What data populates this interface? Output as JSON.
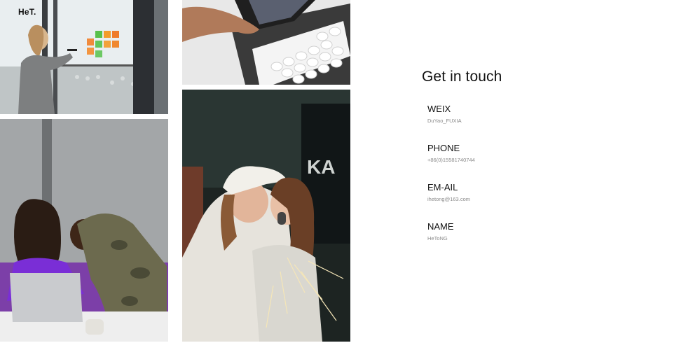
{
  "brand": {
    "logo_text": "HeT."
  },
  "contact": {
    "title": "Get in touch",
    "items": [
      {
        "label": "WEIX",
        "value": "DuYao_FUXIA"
      },
      {
        "label": "PHONE",
        "value": "+86(0)15581740744"
      },
      {
        "label": "EM-AIL",
        "value": "ihetong@163.com"
      },
      {
        "label": "NAME",
        "value": "HeToNG"
      }
    ]
  }
}
